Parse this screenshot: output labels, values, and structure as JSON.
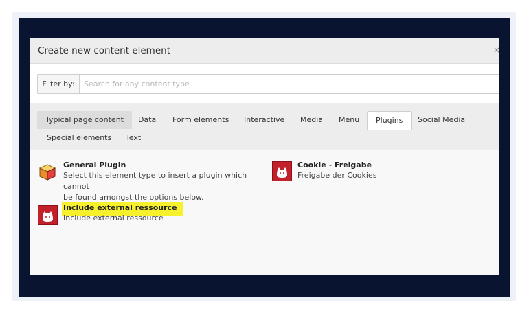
{
  "modal": {
    "title": "Create new content element",
    "close_glyph": "×"
  },
  "filter": {
    "label": "Filter by:",
    "placeholder": "Search for any content type"
  },
  "tabs": [
    {
      "label": "Typical page content",
      "state": "hover"
    },
    {
      "label": "Data",
      "state": "normal"
    },
    {
      "label": "Form elements",
      "state": "normal"
    },
    {
      "label": "Interactive",
      "state": "normal"
    },
    {
      "label": "Media",
      "state": "normal"
    },
    {
      "label": "Menu",
      "state": "normal"
    },
    {
      "label": "Plugins",
      "state": "active"
    },
    {
      "label": "Social Media",
      "state": "normal"
    },
    {
      "label": "Special elements",
      "state": "normal"
    },
    {
      "label": "Text",
      "state": "normal"
    }
  ],
  "elements": [
    {
      "title": "General Plugin",
      "desc_line1": "Select this element type to insert a plugin which cannot",
      "desc_line2": "be found amongst the options below.",
      "icon": "cube-icon"
    },
    {
      "title": "Cookie - Freigabe",
      "desc": "Freigabe der Cookies",
      "icon": "plugin-cat-icon"
    },
    {
      "title": "Include external ressource",
      "desc": "Include external ressource",
      "icon": "plugin-cat-icon",
      "highlighted": true
    }
  ],
  "colors": {
    "backdrop": "#081430",
    "plugin_icon": "#c2202b",
    "highlight": "#f6f12c"
  }
}
